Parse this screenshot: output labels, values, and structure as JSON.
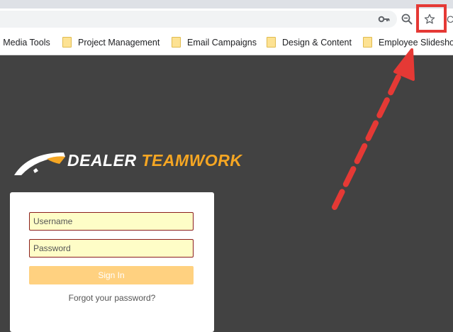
{
  "browser": {
    "icons": {
      "password": "key-icon",
      "zoom": "zoom-out-icon",
      "bookmark": "star-outline-icon"
    },
    "extra_text": "C"
  },
  "bookmarks": [
    {
      "label": "l Media Tools",
      "icon": "none"
    },
    {
      "label": "Project Management",
      "icon": "folder-icon"
    },
    {
      "label": "Email Campaigns",
      "icon": "folder-icon"
    },
    {
      "label": "Design & Content",
      "icon": "folder-icon"
    },
    {
      "label": "Employee Slideshow",
      "icon": "folder-icon"
    }
  ],
  "logo": {
    "word1": "DEALER",
    "word2": "TEAMWORK"
  },
  "login": {
    "username_placeholder": "Username",
    "password_placeholder": "Password",
    "signin_label": "Sign In",
    "forgot_label": "Forgot your password?"
  },
  "annotation": {
    "color": "#e53935"
  },
  "colors": {
    "page_background": "#424242",
    "brand_orange": "#f5a623",
    "signin_button": "#ffd180"
  }
}
